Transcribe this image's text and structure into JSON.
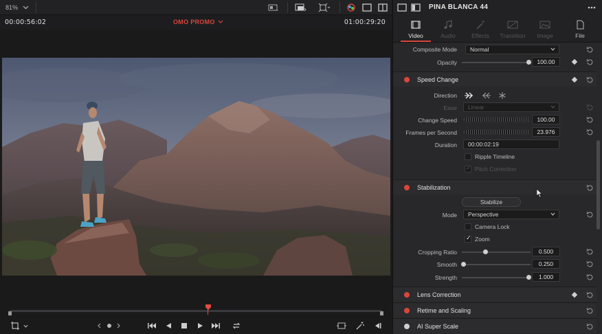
{
  "viewer": {
    "zoom": "81%",
    "timecode_left": "00:00:56:02",
    "timeline_name": "OMO PROMO",
    "timecode_right": "01:00:29:20"
  },
  "inspector": {
    "clip_name": "PINA BLANCA 44",
    "tabs": [
      {
        "label": "Video",
        "icon": "film-icon",
        "active": true
      },
      {
        "label": "Audio",
        "icon": "music-note-icon",
        "active": false
      },
      {
        "label": "Effects",
        "icon": "magic-wand-icon",
        "active": false
      },
      {
        "label": "Transition",
        "icon": "transition-icon",
        "active": false
      },
      {
        "label": "Image",
        "icon": "image-icon",
        "active": false
      },
      {
        "label": "File",
        "icon": "file-icon",
        "active": false
      }
    ],
    "composite": {
      "mode_label": "Composite Mode",
      "mode_value": "Normal",
      "opacity_label": "Opacity",
      "opacity_value": "100.00",
      "opacity_level": 1.0
    },
    "speed_change": {
      "title": "Speed Change",
      "direction_label": "Direction",
      "ease_label": "Ease",
      "ease_value": "Linear",
      "change_speed_label": "Change Speed",
      "change_speed_value": "100.00",
      "fps_label": "Frames per Second",
      "fps_value": "23.976",
      "duration_label": "Duration",
      "duration_value": "00:00:02:19",
      "ripple_label": "Ripple Timeline",
      "pitch_label": "Pitch Correction"
    },
    "stabilization": {
      "title": "Stabilization",
      "stabilize_button": "Stabilize",
      "mode_label": "Mode",
      "mode_value": "Perspective",
      "camera_lock_label": "Camera Lock",
      "zoom_label": "Zoom",
      "cropping_label": "Cropping Ratio",
      "cropping_value": "0.500",
      "cropping_level": 0.3,
      "smooth_label": "Smooth",
      "smooth_value": "0.250",
      "smooth_level": 0.0,
      "strength_label": "Strength",
      "strength_value": "1.000",
      "strength_level": 1.0
    },
    "lens_correction": {
      "title": "Lens Correction"
    },
    "retime_scaling": {
      "title": "Retime and Scaling"
    },
    "ai_super_scale": {
      "title": "AI Super Scale"
    }
  },
  "colors": {
    "accent": "#d9473b",
    "panel": "#28282a",
    "viewer_bg": "#1a1a1b"
  }
}
